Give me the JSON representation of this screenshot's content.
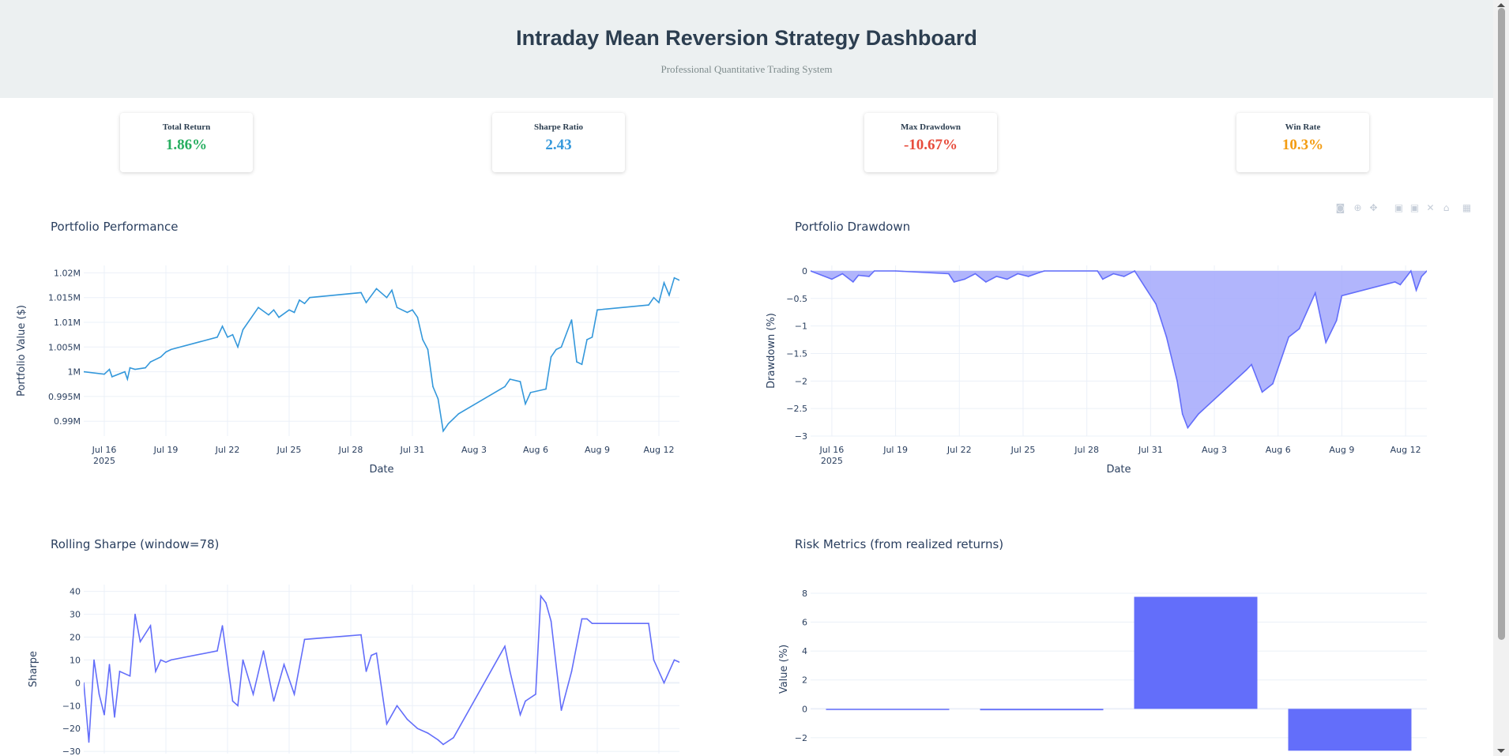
{
  "header": {
    "title": "Intraday Mean Reversion Strategy Dashboard",
    "subtitle": "Professional Quantitative Trading System",
    "background": "#ecf0f1"
  },
  "metrics": [
    {
      "label": "Total Return",
      "value": "1.86%",
      "color": "#27ae60"
    },
    {
      "label": "Sharpe Ratio",
      "value": "2.43",
      "color": "#3498db"
    },
    {
      "label": "Max Drawdown",
      "value": "-10.67%",
      "color": "#e74c3c"
    },
    {
      "label": "Win Rate",
      "value": "10.3%",
      "color": "#f39c12"
    }
  ],
  "modebar": {
    "icons": [
      "camera-icon",
      "zoom-icon",
      "pan-icon",
      "zoom-in-icon",
      "zoom-out-icon",
      "autoscale-icon",
      "reset-axes-icon",
      "plotly-logo-icon"
    ]
  },
  "x_ticks": [
    {
      "date": "2025-07-16",
      "label": "Jul 16",
      "sub": "2025"
    },
    {
      "date": "2025-07-19",
      "label": "Jul 19"
    },
    {
      "date": "2025-07-22",
      "label": "Jul 22"
    },
    {
      "date": "2025-07-25",
      "label": "Jul 25"
    },
    {
      "date": "2025-07-28",
      "label": "Jul 28"
    },
    {
      "date": "2025-07-31",
      "label": "Jul 31"
    },
    {
      "date": "2025-08-03",
      "label": "Aug 3"
    },
    {
      "date": "2025-08-06",
      "label": "Aug 6"
    },
    {
      "date": "2025-08-09",
      "label": "Aug 9"
    },
    {
      "date": "2025-08-12",
      "label": "Aug 12"
    }
  ],
  "chart_data": [
    {
      "type": "line",
      "title": "Portfolio Performance",
      "xlabel": "Date",
      "ylabel": "Portfolio Value ($)",
      "color": "#3498db",
      "xlim": [
        "2025-07-15",
        "2025-08-13"
      ],
      "ylim": [
        987000,
        1021500
      ],
      "yticks": [
        {
          "value": 990000,
          "label": "0.99M"
        },
        {
          "value": 995000,
          "label": "0.995M"
        },
        {
          "value": 1000000,
          "label": "1M"
        },
        {
          "value": 1005000,
          "label": "1.005M"
        },
        {
          "value": 1010000,
          "label": "1.01M"
        },
        {
          "value": 1015000,
          "label": "1.015M"
        },
        {
          "value": 1020000,
          "label": "1.02M"
        }
      ],
      "x": [
        "2025-07-15 00:00",
        "2025-07-16 00:00",
        "2025-07-16 06:00",
        "2025-07-16 09:00",
        "2025-07-17 00:00",
        "2025-07-17 03:00",
        "2025-07-17 06:00",
        "2025-07-17 12:00",
        "2025-07-18 00:00",
        "2025-07-18 06:00",
        "2025-07-18 18:00",
        "2025-07-19 00:00",
        "2025-07-19 06:00",
        "2025-07-21 12:00",
        "2025-07-21 18:00",
        "2025-07-22 00:00",
        "2025-07-22 06:00",
        "2025-07-22 12:00",
        "2025-07-22 18:00",
        "2025-07-23 12:00",
        "2025-07-24 00:00",
        "2025-07-24 06:00",
        "2025-07-24 12:00",
        "2025-07-25 00:00",
        "2025-07-25 06:00",
        "2025-07-25 12:00",
        "2025-07-25 18:00",
        "2025-07-26 00:00",
        "2025-07-28 12:00",
        "2025-07-28 18:00",
        "2025-07-29 06:00",
        "2025-07-29 18:00",
        "2025-07-30 00:00",
        "2025-07-30 06:00",
        "2025-07-30 18:00",
        "2025-07-31 00:00",
        "2025-07-31 06:00",
        "2025-07-31 12:00",
        "2025-07-31 18:00",
        "2025-08-01 00:00",
        "2025-08-01 06:00",
        "2025-08-01 12:00",
        "2025-08-01 18:00",
        "2025-08-02 00:00",
        "2025-08-02 06:00",
        "2025-08-04 12:00",
        "2025-08-04 18:00",
        "2025-08-05 06:00",
        "2025-08-05 12:00",
        "2025-08-05 18:00",
        "2025-08-06 12:00",
        "2025-08-06 18:00",
        "2025-08-07 00:00",
        "2025-08-07 06:00",
        "2025-08-07 18:00",
        "2025-08-08 00:00",
        "2025-08-08 06:00",
        "2025-08-08 12:00",
        "2025-08-08 18:00",
        "2025-08-09 00:00",
        "2025-08-11 12:00",
        "2025-08-11 18:00",
        "2025-08-12 00:00",
        "2025-08-12 06:00",
        "2025-08-12 12:00",
        "2025-08-12 18:00",
        "2025-08-13 00:00"
      ],
      "y": [
        1000000,
        999500,
        1000500,
        999000,
        1000000,
        998500,
        1000800,
        1000500,
        1000800,
        1002000,
        1003000,
        1004000,
        1004500,
        1007000,
        1009200,
        1007000,
        1007500,
        1005000,
        1008500,
        1013000,
        1011500,
        1012500,
        1011000,
        1012500,
        1012000,
        1014500,
        1013800,
        1015000,
        1016000,
        1014000,
        1016800,
        1015000,
        1016500,
        1013000,
        1012000,
        1012500,
        1011000,
        1006500,
        1004500,
        997000,
        994500,
        988000,
        989500,
        990500,
        991500,
        997000,
        998500,
        998000,
        993500,
        995800,
        996500,
        1003000,
        1004500,
        1005000,
        1010500,
        1002000,
        1001500,
        1006500,
        1007000,
        1012500,
        1013500,
        1015000,
        1014000,
        1018000,
        1015500,
        1019000,
        1018500
      ]
    },
    {
      "type": "area",
      "title": "Portfolio Drawdown",
      "xlabel": "Date",
      "ylabel": "Drawdown (%)",
      "color": "#636efa",
      "fill": "#a3a8fb",
      "xlim": [
        "2025-07-15",
        "2025-08-13"
      ],
      "ylim": [
        -3,
        0.1
      ],
      "yticks": [
        {
          "value": 0,
          "label": "0"
        },
        {
          "value": -0.5,
          "label": "−0.5"
        },
        {
          "value": -1,
          "label": "−1"
        },
        {
          "value": -1.5,
          "label": "−1.5"
        },
        {
          "value": -2,
          "label": "−2"
        },
        {
          "value": -2.5,
          "label": "−2.5"
        },
        {
          "value": -3,
          "label": "−3"
        }
      ],
      "x": [
        "2025-07-15 00:00",
        "2025-07-16 00:00",
        "2025-07-16 12:00",
        "2025-07-17 00:00",
        "2025-07-17 06:00",
        "2025-07-17 18:00",
        "2025-07-18 00:00",
        "2025-07-19 00:00",
        "2025-07-21 12:00",
        "2025-07-21 18:00",
        "2025-07-22 06:00",
        "2025-07-22 18:00",
        "2025-07-23 06:00",
        "2025-07-23 18:00",
        "2025-07-24 06:00",
        "2025-07-24 18:00",
        "2025-07-25 06:00",
        "2025-07-25 18:00",
        "2025-07-26 00:00",
        "2025-07-28 12:00",
        "2025-07-28 18:00",
        "2025-07-29 06:00",
        "2025-07-29 18:00",
        "2025-07-30 06:00",
        "2025-07-30 18:00",
        "2025-07-31 06:00",
        "2025-07-31 18:00",
        "2025-08-01 06:00",
        "2025-08-01 12:00",
        "2025-08-01 18:00",
        "2025-08-02 06:00",
        "2025-08-04 12:00",
        "2025-08-04 18:00",
        "2025-08-05 06:00",
        "2025-08-05 18:00",
        "2025-08-06 12:00",
        "2025-08-07 00:00",
        "2025-08-07 18:00",
        "2025-08-08 06:00",
        "2025-08-08 18:00",
        "2025-08-09 00:00",
        "2025-08-11 12:00",
        "2025-08-11 18:00",
        "2025-08-12 06:00",
        "2025-08-12 12:00",
        "2025-08-12 18:00",
        "2025-08-13 00:00"
      ],
      "y": [
        0,
        -0.15,
        -0.05,
        -0.2,
        -0.08,
        -0.1,
        0,
        0,
        -0.05,
        -0.2,
        -0.15,
        -0.05,
        -0.2,
        -0.1,
        -0.15,
        -0.05,
        -0.1,
        -0.03,
        0,
        0,
        -0.15,
        -0.05,
        -0.1,
        0,
        -0.3,
        -0.6,
        -1.2,
        -2,
        -2.6,
        -2.85,
        -2.6,
        -1.8,
        -1.7,
        -2.2,
        -2.05,
        -1.2,
        -1.05,
        -0.4,
        -1.3,
        -0.9,
        -0.45,
        -0.2,
        -0.25,
        0,
        -0.35,
        -0.1,
        0
      ]
    },
    {
      "type": "line",
      "title": "Rolling Sharpe (window=78)",
      "xlabel": "",
      "ylabel": "Sharpe",
      "color": "#636efa",
      "xlim": [
        "2025-07-15",
        "2025-08-13"
      ],
      "ylim": [
        -31,
        43
      ],
      "yticks": [
        {
          "value": -30,
          "label": "−30"
        },
        {
          "value": -20,
          "label": "−20"
        },
        {
          "value": -10,
          "label": "−10"
        },
        {
          "value": 0,
          "label": "0"
        },
        {
          "value": 10,
          "label": "10"
        },
        {
          "value": 20,
          "label": "20"
        },
        {
          "value": 30,
          "label": "30"
        },
        {
          "value": 40,
          "label": "40"
        }
      ],
      "x": [
        "2025-07-15 00:00",
        "2025-07-15 06:00",
        "2025-07-15 12:00",
        "2025-07-15 18:00",
        "2025-07-16 00:00",
        "2025-07-16 06:00",
        "2025-07-16 12:00",
        "2025-07-16 18:00",
        "2025-07-17 06:00",
        "2025-07-17 12:00",
        "2025-07-17 18:00",
        "2025-07-18 06:00",
        "2025-07-18 12:00",
        "2025-07-18 18:00",
        "2025-07-19 00:00",
        "2025-07-19 06:00",
        "2025-07-21 12:00",
        "2025-07-21 18:00",
        "2025-07-22 06:00",
        "2025-07-22 12:00",
        "2025-07-22 18:00",
        "2025-07-23 06:00",
        "2025-07-23 18:00",
        "2025-07-24 06:00",
        "2025-07-24 18:00",
        "2025-07-25 06:00",
        "2025-07-25 18:00",
        "2025-07-28 12:00",
        "2025-07-28 18:00",
        "2025-07-29 00:00",
        "2025-07-29 06:00",
        "2025-07-29 18:00",
        "2025-07-30 06:00",
        "2025-07-30 18:00",
        "2025-07-31 06:00",
        "2025-07-31 18:00",
        "2025-08-01 06:00",
        "2025-08-01 12:00",
        "2025-08-02 00:00",
        "2025-08-04 12:00",
        "2025-08-04 18:00",
        "2025-08-05 06:00",
        "2025-08-05 12:00",
        "2025-08-06 00:00",
        "2025-08-06 06:00",
        "2025-08-06 12:00",
        "2025-08-06 18:00",
        "2025-08-07 06:00",
        "2025-08-07 18:00",
        "2025-08-08 06:00",
        "2025-08-08 12:00",
        "2025-08-08 18:00",
        "2025-08-11 12:00",
        "2025-08-11 18:00",
        "2025-08-12 06:00",
        "2025-08-12 18:00",
        "2025-08-13 00:00"
      ],
      "y": [
        0,
        -26,
        10,
        -5,
        -14,
        8,
        -15,
        5,
        3,
        30,
        18,
        25,
        5,
        10,
        9,
        10,
        14,
        25,
        -8,
        -10,
        10,
        -5,
        14,
        -8,
        8,
        -5,
        19,
        21,
        5,
        12,
        13,
        -18,
        -10,
        -16,
        -20,
        -22,
        -25,
        -27,
        -24,
        16,
        5,
        -14,
        -8,
        -5,
        38,
        35,
        27,
        -12,
        5,
        28,
        28,
        26,
        26,
        10,
        0,
        10,
        9
      ]
    },
    {
      "type": "bar",
      "title": "Risk Metrics (from realized returns)",
      "xlabel": "",
      "ylabel": "Value (%)",
      "color": "#636efa",
      "ylim": [
        -3.1,
        8.6
      ],
      "yticks": [
        {
          "value": -2,
          "label": "−2"
        },
        {
          "value": 0,
          "label": "0"
        },
        {
          "value": 2,
          "label": "2"
        },
        {
          "value": 4,
          "label": "4"
        },
        {
          "value": 6,
          "label": "6"
        },
        {
          "value": 8,
          "label": "8"
        }
      ],
      "values": [
        -0.04,
        -0.1,
        7.75,
        -2.9
      ]
    }
  ]
}
